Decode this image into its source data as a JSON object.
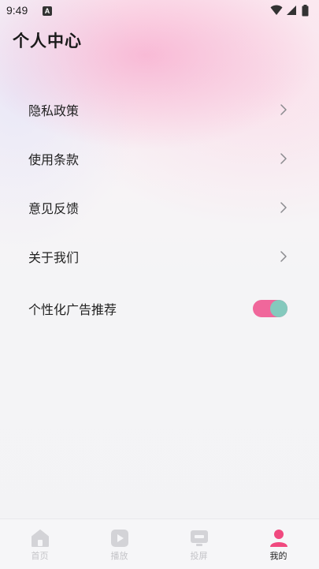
{
  "status_bar": {
    "time": "9:49",
    "notification_badge": "A",
    "icons": [
      "wifi-icon",
      "signal-icon",
      "battery-icon"
    ]
  },
  "page": {
    "title": "个人中心"
  },
  "menu": [
    {
      "label": "隐私政策",
      "type": "link"
    },
    {
      "label": "使用条款",
      "type": "link"
    },
    {
      "label": "意见反馈",
      "type": "link"
    },
    {
      "label": "关于我们",
      "type": "link"
    },
    {
      "label": "个性化广告推荐",
      "type": "toggle",
      "enabled": true
    }
  ],
  "tabs": [
    {
      "label": "首页",
      "icon": "home-icon",
      "active": false
    },
    {
      "label": "播放",
      "icon": "play-icon",
      "active": false
    },
    {
      "label": "投屏",
      "icon": "cast-screen-icon",
      "active": false
    },
    {
      "label": "我的",
      "icon": "profile-icon",
      "active": true
    }
  ],
  "colors": {
    "accent": "#f0679b",
    "toggle_knob": "#84c9bd",
    "tab_inactive": "#c4c4c8",
    "tab_active_icon": "#f0497f"
  }
}
